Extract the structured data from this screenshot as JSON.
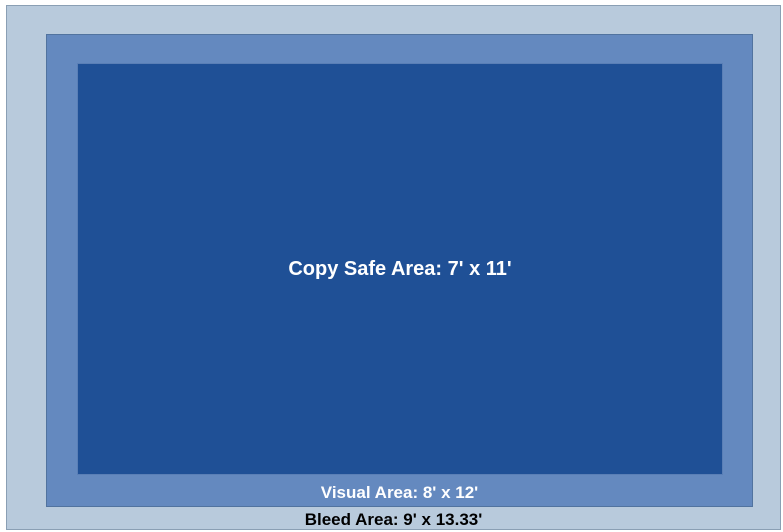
{
  "areas": {
    "copy_safe": {
      "label": "Copy Safe Area: 7' x 11'",
      "color": "#1f5096"
    },
    "visual": {
      "label": "Visual Area: 8' x 12'",
      "color": "#6489bf"
    },
    "bleed": {
      "label": "Bleed Area: 9' x 13.33'",
      "color": "#b8cadc"
    }
  }
}
